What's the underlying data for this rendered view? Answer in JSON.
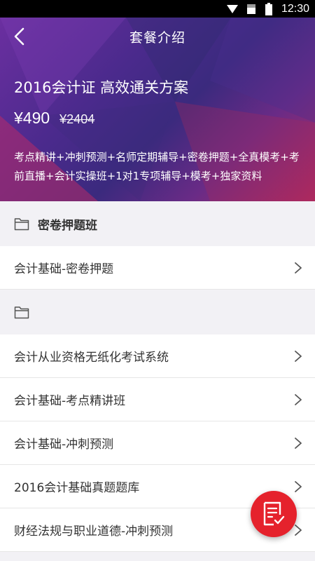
{
  "status_bar": {
    "time": "12:30"
  },
  "header": {
    "title": "套餐介绍"
  },
  "package": {
    "title": "2016会计证 高效通关方案",
    "price": "¥490",
    "original_price": "¥2404",
    "description": "考点精讲+冲刺预测+名师定期辅导+密卷押题+全真模考+考前直播+会计实操班+1对1专项辅导+模考+独家资料"
  },
  "sections": [
    {
      "title": "密卷押题班",
      "items": [
        "会计基础-密卷押题"
      ]
    },
    {
      "title": "",
      "items": [
        "会计从业资格无纸化考试系统",
        "会计基础-考点精讲班",
        "会计基础-冲刺预测",
        "2016会计基础真题题库",
        "财经法规与职业道德-冲刺预测"
      ]
    }
  ]
}
